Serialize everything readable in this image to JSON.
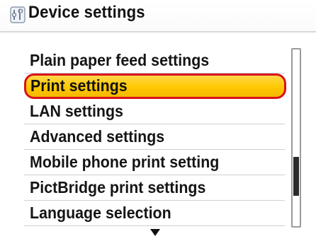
{
  "header": {
    "title": "Device settings",
    "icon": "settings-wrench-icon"
  },
  "menu": {
    "items": [
      {
        "label": "Plain paper feed settings",
        "selected": false
      },
      {
        "label": "Print settings",
        "selected": true
      },
      {
        "label": "LAN settings",
        "selected": false
      },
      {
        "label": "Advanced settings",
        "selected": false
      },
      {
        "label": "Mobile phone print setting",
        "selected": false
      },
      {
        "label": "PictBridge print settings",
        "selected": false
      },
      {
        "label": "Language selection",
        "selected": false
      }
    ],
    "more_indicator": "down-arrow-icon"
  },
  "scrollbar": {
    "position_fraction": 0.78,
    "visible_fraction": 0.22
  },
  "colors": {
    "highlight_fill": "#ffc800",
    "highlight_border": "#d8121a",
    "text": "#151515"
  }
}
